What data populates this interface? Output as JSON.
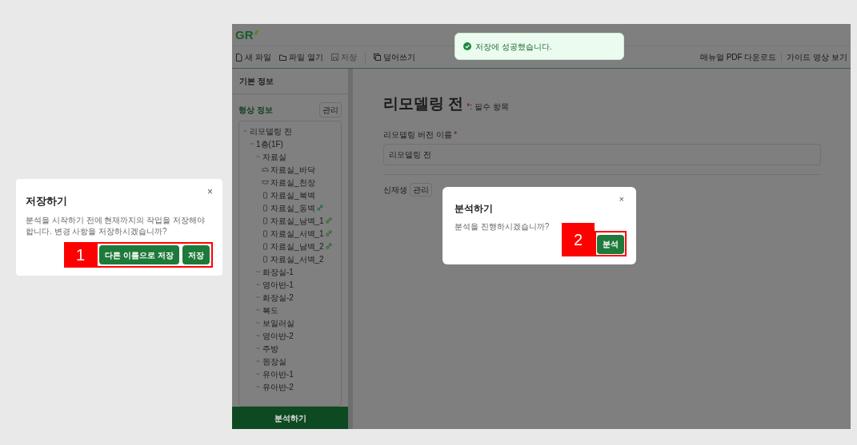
{
  "save_dialog": {
    "title": "저장하기",
    "message": "분석을 시작하기 전에 현재까지의 작업을 저장해야 합니다. 변경 사항을 저장하시겠습니까?",
    "close": "×",
    "callout": "1",
    "buttons": [
      "다른 이름으로 저장",
      "저장"
    ]
  },
  "app": {
    "logo": "GR",
    "toolbar": [
      {
        "label": "새 파일",
        "kind": "file",
        "disabled": false
      },
      {
        "label": "파일 열기",
        "kind": "folder",
        "disabled": false
      },
      {
        "label": "저장",
        "kind": "save",
        "disabled": true
      },
      {
        "label": "덮어쓰기",
        "kind": "overwrite",
        "disabled": false
      }
    ],
    "links": [
      "매뉴얼 PDF 다운로드",
      "가이드 영상 보기"
    ],
    "toast": {
      "message": "저장에 성공했습니다."
    },
    "sidebar": {
      "basic_info": "기본 정보",
      "shape_info": "형상 정보",
      "manage": "관리",
      "tree": [
        {
          "label": "리모델링 전",
          "kind": "group",
          "expanded": true,
          "children": [
            {
              "label": "1층(1F)",
              "kind": "group",
              "expanded": true,
              "children": [
                {
                  "label": "자료실",
                  "kind": "group",
                  "expanded": true,
                  "children": [
                    {
                      "label": "자료실_바닥",
                      "kind": "floor",
                      "linked": false
                    },
                    {
                      "label": "자료실_천장",
                      "kind": "ceiling",
                      "linked": false
                    },
                    {
                      "label": "자료실_북벽",
                      "kind": "wall",
                      "linked": false
                    },
                    {
                      "label": "자료실_동벽",
                      "kind": "wall",
                      "linked": true
                    },
                    {
                      "label": "자료실_남벽_1",
                      "kind": "wall",
                      "linked": true
                    },
                    {
                      "label": "자료실_서벽_1",
                      "kind": "wall",
                      "linked": true
                    },
                    {
                      "label": "자료실_남벽_2",
                      "kind": "wall",
                      "linked": true
                    },
                    {
                      "label": "자료실_서벽_2",
                      "kind": "wall",
                      "linked": false
                    }
                  ]
                },
                {
                  "label": "화장실-1",
                  "kind": "group",
                  "expanded": false
                },
                {
                  "label": "영아반-1",
                  "kind": "group",
                  "expanded": false
                },
                {
                  "label": "화장실-2",
                  "kind": "group",
                  "expanded": false
                },
                {
                  "label": "복도",
                  "kind": "group",
                  "expanded": false
                },
                {
                  "label": "보일러실",
                  "kind": "group",
                  "expanded": false
                },
                {
                  "label": "영아반-2",
                  "kind": "group",
                  "expanded": false
                },
                {
                  "label": "주방",
                  "kind": "group",
                  "expanded": false
                },
                {
                  "label": "원장실",
                  "kind": "group",
                  "expanded": false
                },
                {
                  "label": "유아반-1",
                  "kind": "group",
                  "expanded": false
                },
                {
                  "label": "유아반-2",
                  "kind": "group",
                  "expanded": false
                }
              ]
            }
          ]
        }
      ],
      "analyze_button": "분석하기"
    }
  },
  "main": {
    "title": "리모델링 전",
    "required_note": "*: 필수 항목",
    "field_label": "리모델링 버전 이름",
    "field_required_mark": "*",
    "field_value": "리모델링 전",
    "renewable": "신재생",
    "manage": "관리"
  },
  "analyze_dialog": {
    "title": "분석하기",
    "message": "분석을 진행하시겠습니까?",
    "close": "×",
    "callout": "2",
    "button": "분석"
  }
}
